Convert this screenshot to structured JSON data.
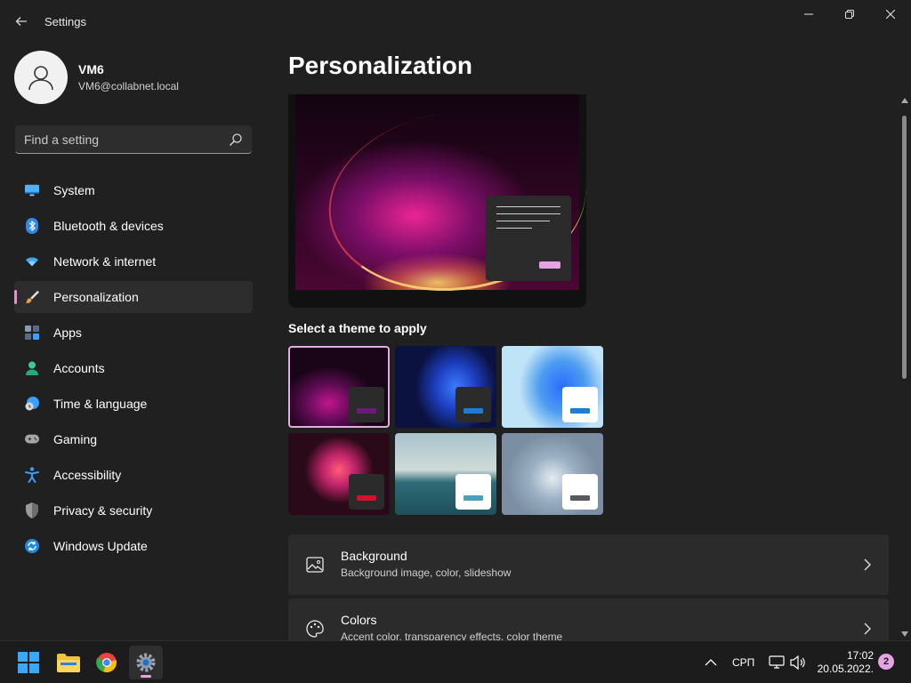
{
  "window": {
    "title": "Settings"
  },
  "profile": {
    "name": "VM6",
    "email": "VM6@collabnet.local"
  },
  "search": {
    "placeholder": "Find a setting"
  },
  "sidebar": {
    "items": [
      {
        "label": "System",
        "icon": "system-icon"
      },
      {
        "label": "Bluetooth & devices",
        "icon": "bluetooth-icon"
      },
      {
        "label": "Network & internet",
        "icon": "wifi-icon"
      },
      {
        "label": "Personalization",
        "icon": "brush-icon",
        "active": true
      },
      {
        "label": "Apps",
        "icon": "apps-icon"
      },
      {
        "label": "Accounts",
        "icon": "accounts-icon"
      },
      {
        "label": "Time & language",
        "icon": "clock-globe-icon"
      },
      {
        "label": "Gaming",
        "icon": "gamepad-icon"
      },
      {
        "label": "Accessibility",
        "icon": "accessibility-icon"
      },
      {
        "label": "Privacy & security",
        "icon": "shield-icon"
      },
      {
        "label": "Windows Update",
        "icon": "update-icon"
      }
    ]
  },
  "main": {
    "page_title": "Personalization",
    "theme_heading": "Select a theme to apply",
    "themes": [
      {
        "name": "windows-11-glow-dark",
        "accent": "#6a1b7a",
        "card": "#2b2b2b",
        "selected": true
      },
      {
        "name": "windows-dark-bloom",
        "accent": "#1a7fd4",
        "card": "#2b2b2b"
      },
      {
        "name": "windows-light-bloom",
        "accent": "#1a7fd4",
        "card": "#ffffff"
      },
      {
        "name": "captured-motion",
        "accent": "#d3122a",
        "card": "#2b2b2b"
      },
      {
        "name": "glow-lake",
        "accent": "#4aa0b8",
        "card": "#ffffff"
      },
      {
        "name": "sunrise-flow",
        "accent": "#555a60",
        "card": "#ffffff"
      }
    ],
    "settings": [
      {
        "title": "Background",
        "subtitle": "Background image, color, slideshow",
        "icon": "image-icon"
      },
      {
        "title": "Colors",
        "subtitle": "Accent color, transparency effects, color theme",
        "icon": "palette-icon"
      }
    ]
  },
  "taskbar": {
    "language": "СРП",
    "time": "17:02",
    "date": "20.05.2022.",
    "notifications": "2",
    "apps": [
      "start-icon",
      "file-explorer-icon",
      "chrome-icon",
      "settings-icon"
    ]
  },
  "colors": {
    "accent": "#e5a3e3",
    "background": "#202020",
    "card": "#2b2b2b"
  }
}
